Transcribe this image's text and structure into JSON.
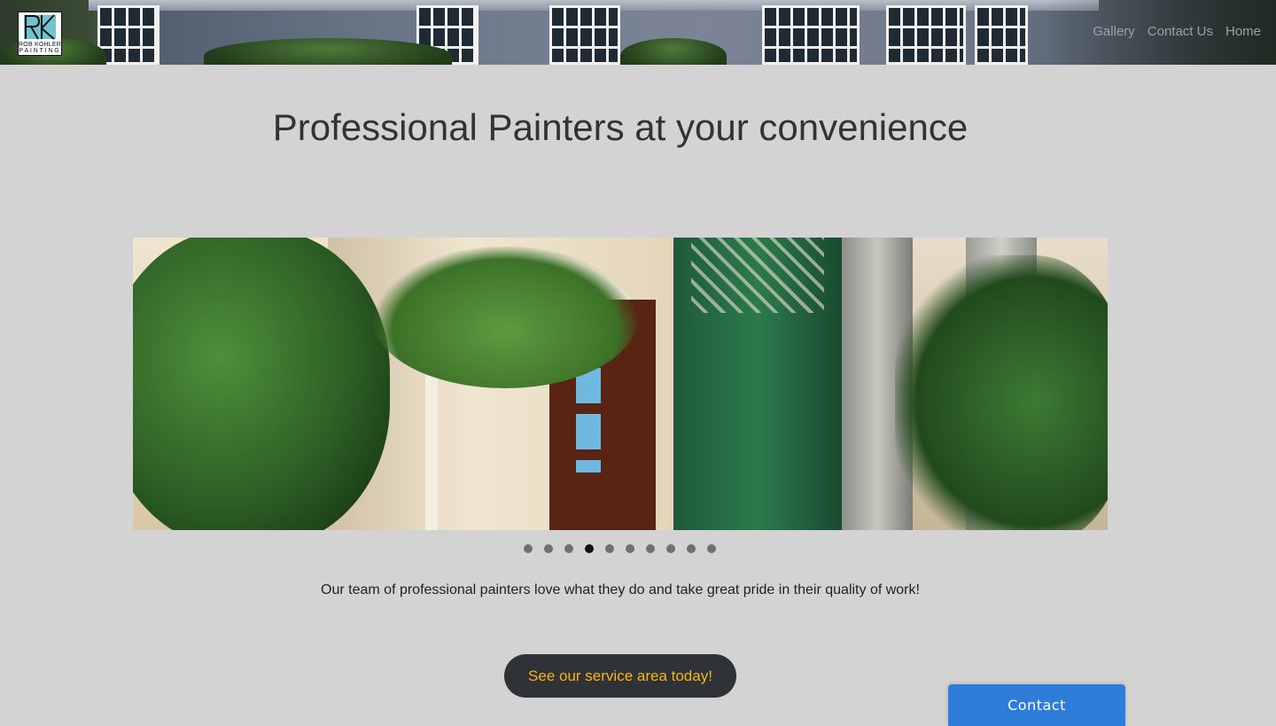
{
  "header": {
    "logo": {
      "line1": "ROB KOHLER",
      "line2": "PAINTING",
      "monogram": "RK"
    },
    "nav": [
      {
        "label": "Gallery"
      },
      {
        "label": "Contact Us"
      },
      {
        "label": "Home"
      }
    ]
  },
  "main": {
    "headline": "Professional Painters at your convenience",
    "slideshow": {
      "slide_count": 10,
      "active_slide": 4
    },
    "caption": "Our team of professional painters love what they do and take great pride in their quality of work!",
    "cta_label": "See our service area today!"
  },
  "contact_widget": {
    "label": "Contact"
  },
  "colors": {
    "background": "#d3d3d3",
    "cta_bg": "#2f3237",
    "cta_text": "#f6b41d",
    "contact_bg": "#2f7ddb",
    "dot_active": "#111111",
    "dot_inactive": "#707070"
  }
}
